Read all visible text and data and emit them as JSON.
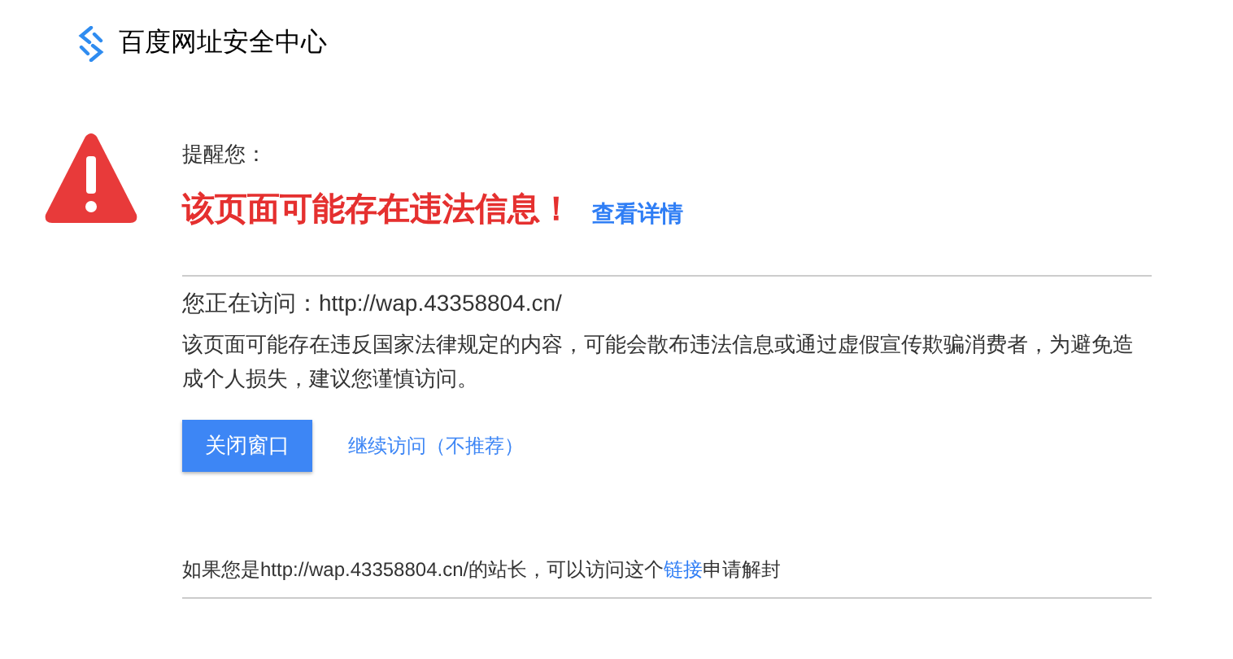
{
  "header": {
    "title": "百度网址安全中心"
  },
  "warning": {
    "prompt": "提醒您：",
    "headline": "该页面可能存在违法信息！",
    "details_link": "查看详情"
  },
  "visiting": "您正在访问：http://wap.43358804.cn/",
  "description": "该页面可能存在违反国家法律规定的内容，可能会散布违法信息或通过虚假宣传欺骗消费者，为避免造成个人损失，建议您谨慎访问。",
  "buttons": [
    {
      "kind": "primary",
      "label": "关闭窗口"
    },
    {
      "kind": "link",
      "label": "继续访问（不推荐）"
    }
  ],
  "footer": {
    "before": "如果您是http://wap.43358804.cn/的站长，可以访问这个",
    "link": "链接",
    "after": "申请解封"
  }
}
